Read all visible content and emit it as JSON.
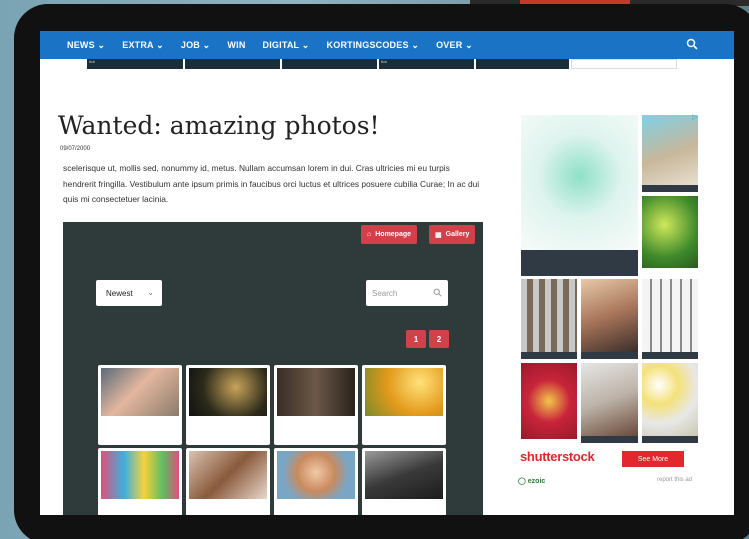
{
  "nav": {
    "items": [
      {
        "label": "NEWS ⌄"
      },
      {
        "label": "EXTRA ⌄"
      },
      {
        "label": "JOB ⌄"
      },
      {
        "label": "WIN"
      },
      {
        "label": "DIGITAL ⌄"
      },
      {
        "label": "KORTINGSCODES ⌄"
      },
      {
        "label": "OVER ⌄"
      }
    ],
    "search_icon": "search-icon",
    "color": "#1a73c4"
  },
  "ad_strip": {
    "cells": [
      "tick",
      "",
      "",
      "tick",
      "",
      ""
    ]
  },
  "article": {
    "title": "Wanted: amazing photos!",
    "date": "09/07/2000",
    "body": "scelerisque ut, mollis sed, nonummy id, metus. Nullam accumsan lorem in dui. Cras ultricies mi eu turpis hendrerit fringilla. Vestibulum ante ipsum primis in faucibus orci luctus et ultrices posuere cubilia Curae; In ac dui quis mi consectetuer lacinia."
  },
  "gallery": {
    "homepage_label": "Homepage",
    "gallery_label": "Gallery",
    "sort_value": "Newest",
    "search_placeholder": "Search",
    "pages": [
      "1",
      "2"
    ],
    "accent": "#d0414a",
    "background": "#2f3b3a"
  },
  "sidebar_ad": {
    "brand": "shutterstock",
    "cta": "See More",
    "ezoic": "ezoic",
    "report": "report this ad",
    "brand_color": "#e2282d"
  }
}
